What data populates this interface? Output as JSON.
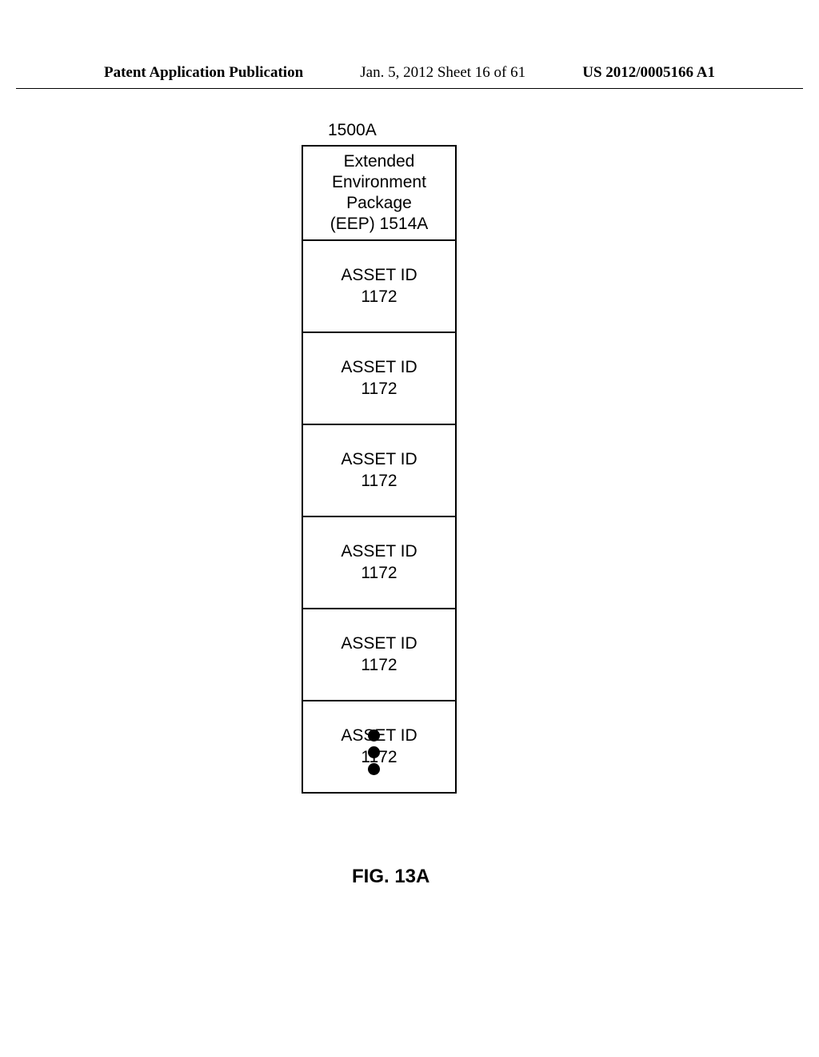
{
  "header": {
    "left": "Patent Application Publication",
    "center": "Jan. 5, 2012  Sheet 16 of 61",
    "right": "US 2012/0005166 A1"
  },
  "diagram": {
    "reference": "1500A",
    "header_cell": {
      "line1": "Extended",
      "line2": "Environment",
      "line3": "Package",
      "line4": "(EEP) 1514A"
    },
    "items": [
      {
        "label": "ASSET ID",
        "ref": "1172"
      },
      {
        "label": "ASSET ID",
        "ref": "1172"
      },
      {
        "label": "ASSET ID",
        "ref": "1172"
      },
      {
        "label": "ASSET ID",
        "ref": "1172"
      },
      {
        "label": "ASSET ID",
        "ref": "1172"
      },
      {
        "label": "ASSET ID",
        "ref": "1172"
      }
    ],
    "figure_label": "FIG. 13A"
  }
}
